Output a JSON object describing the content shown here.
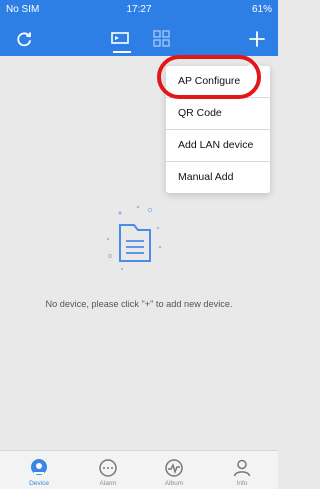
{
  "status_bar": {
    "carrier": "No SIM",
    "time": "17:27",
    "battery": "61%"
  },
  "top_nav": {
    "icons": [
      "refresh-icon",
      "device-list-icon",
      "grid-view-icon",
      "plus-icon"
    ],
    "accent_color": "#2d7fe6"
  },
  "add_menu": {
    "items": [
      "AP Configure",
      "QR Code",
      "Add LAN device",
      "Manual Add"
    ],
    "highlight_color": "#e1171a"
  },
  "empty_state": {
    "message": "No device, please click \"+\" to add new device."
  },
  "tab_bar": {
    "tabs": [
      {
        "label": "Device",
        "icon": "device-icon",
        "active": true
      },
      {
        "label": "Alarm",
        "icon": "alarm-icon",
        "active": false
      },
      {
        "label": "Album",
        "icon": "album-icon",
        "active": false
      },
      {
        "label": "Info",
        "icon": "info-icon",
        "active": false
      }
    ],
    "active_color": "#3a86e6"
  }
}
